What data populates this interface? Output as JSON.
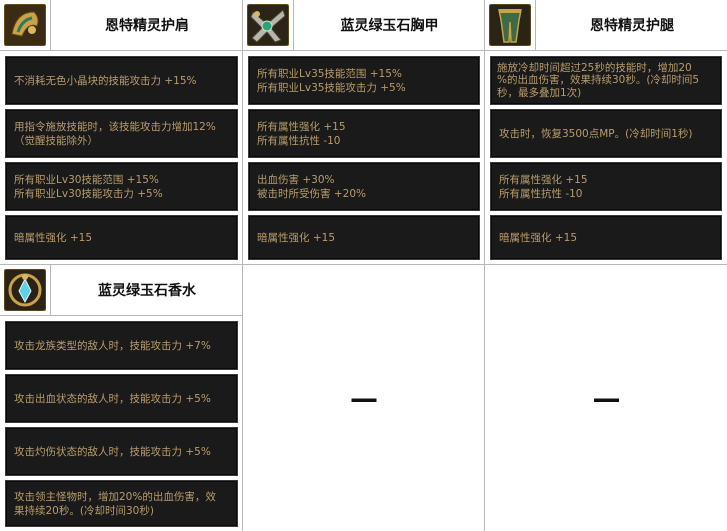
{
  "items": [
    {
      "title": "恩特精灵护肩",
      "icon": "shoulder-armor-icon",
      "effects": [
        [
          "不消耗无色小晶块的技能攻击力 +15%"
        ],
        [
          "用指令施放技能时，该技能攻击力增加12%",
          "（觉醒技能除外）"
        ],
        [
          "所有职业Lv30技能范围 +15%",
          "所有职业Lv30技能攻击力 +5%"
        ],
        [
          "暗属性强化 +15"
        ]
      ]
    },
    {
      "title": "蓝灵绿玉石胸甲",
      "icon": "chest-armor-icon",
      "effects": [
        [
          "所有职业Lv35技能范围 +15%",
          "所有职业Lv35技能攻击力 +5%"
        ],
        [
          "所有属性强化 +15",
          "所有属性抗性 -10"
        ],
        [
          "出血伤害 +30%",
          "被击时所受伤害 +20%"
        ],
        [
          "暗属性强化 +15"
        ]
      ]
    },
    {
      "title": "恩特精灵护腿",
      "icon": "leg-armor-icon",
      "effects": [
        [
          "施放冷却时间超过25秒的技能时，增加20",
          "%的出血伤害，效果持续30秒。(冷却时间5",
          "秒，最多叠加1次)"
        ],
        [
          "攻击时，恢复3500点MP。(冷却时间1秒)"
        ],
        [
          "所有属性强化 +15",
          "所有属性抗性 -10"
        ],
        [
          "暗属性强化 +15"
        ]
      ]
    },
    {
      "title": "蓝灵绿玉石香水",
      "icon": "perfume-bottle-icon",
      "effects": [
        [
          "攻击龙族类型的敌人时，技能攻击力 +7%"
        ],
        [
          "攻击出血状态的敌人时，技能攻击力 +5%"
        ],
        [
          "攻击灼伤状态的敌人时，技能攻击力 +5%"
        ],
        [
          "攻击领主怪物时，增加20%的出血伤害，效",
          "果持续20秒。(冷却时间30秒)"
        ]
      ]
    }
  ],
  "empty_cells": [
    {
      "text": "—"
    },
    {
      "text": "—"
    }
  ]
}
